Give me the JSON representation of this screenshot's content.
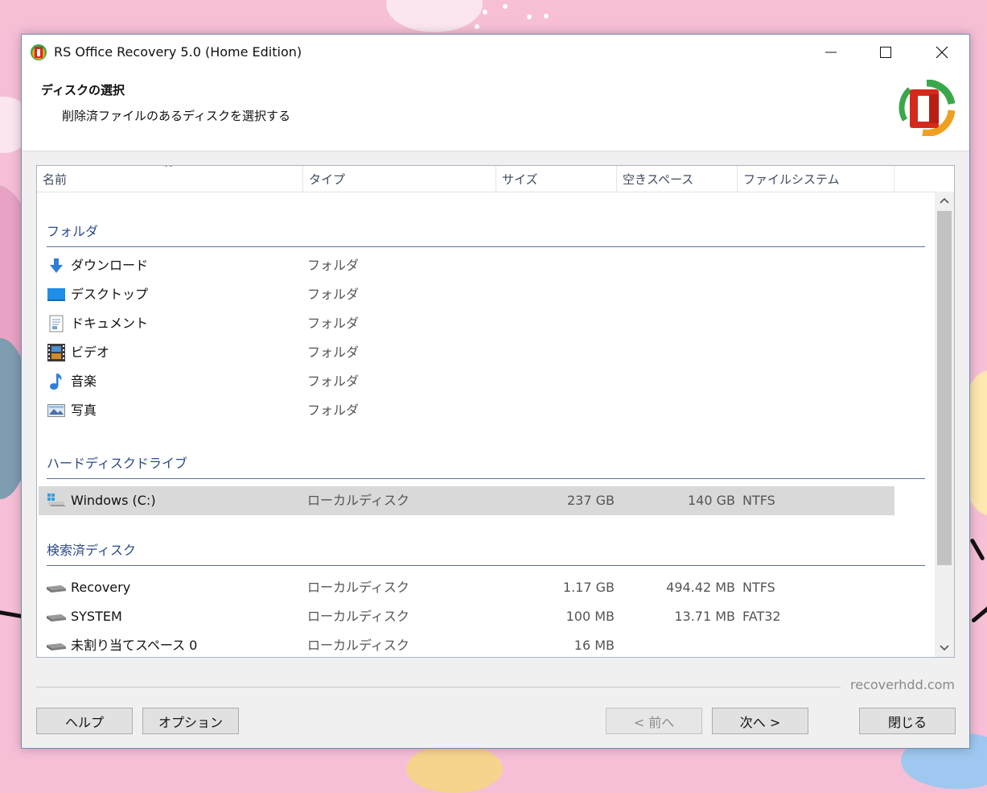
{
  "window": {
    "title": "RS Office Recovery 5.0 (Home Edition)",
    "controls": {
      "minimize": "minimize-icon",
      "maximize": "maximize-icon",
      "close": "close-icon"
    }
  },
  "header": {
    "title": "ディスクの選択",
    "subtitle": "削除済ファイルのあるディスクを選択する"
  },
  "columns": {
    "name": "名前",
    "type": "タイプ",
    "size": "サイズ",
    "free": "空きスペース",
    "fs": "ファイルシステム",
    "sort_indicator": "^"
  },
  "groups": {
    "folders": {
      "label": "フォルダ",
      "items": [
        {
          "name": "ダウンロード",
          "type": "フォルダ",
          "icon": "download-arrow-icon"
        },
        {
          "name": "デスクトップ",
          "type": "フォルダ",
          "icon": "desktop-icon"
        },
        {
          "name": "ドキュメント",
          "type": "フォルダ",
          "icon": "document-icon"
        },
        {
          "name": "ビデオ",
          "type": "フォルダ",
          "icon": "video-icon"
        },
        {
          "name": "音楽",
          "type": "フォルダ",
          "icon": "music-note-icon"
        },
        {
          "name": "写真",
          "type": "フォルダ",
          "icon": "picture-icon"
        }
      ]
    },
    "hdd": {
      "label": "ハードディスクドライブ",
      "items": [
        {
          "name": "Windows (C:)",
          "type": "ローカルディスク",
          "size": "237 GB",
          "free": "140 GB",
          "fs": "NTFS",
          "icon": "windows-drive-icon",
          "selected": true
        }
      ]
    },
    "found": {
      "label": "検索済ディスク",
      "items": [
        {
          "name": "Recovery",
          "type": "ローカルディスク",
          "size": "1.17 GB",
          "free": "494.42 MB",
          "fs": "NTFS",
          "icon": "disk-icon"
        },
        {
          "name": "SYSTEM",
          "type": "ローカルディスク",
          "size": "100 MB",
          "free": "13.71 MB",
          "fs": "FAT32",
          "icon": "disk-icon"
        },
        {
          "name": "未割り当てスペース 0",
          "type": "ローカルディスク",
          "size": "16 MB",
          "free": "",
          "fs": "",
          "icon": "disk-icon"
        }
      ]
    }
  },
  "footer": {
    "site": "recoverhdd.com",
    "help": "ヘルプ",
    "options": "オプション",
    "back": "< 前へ",
    "next": "次へ >",
    "close": "閉じる"
  }
}
